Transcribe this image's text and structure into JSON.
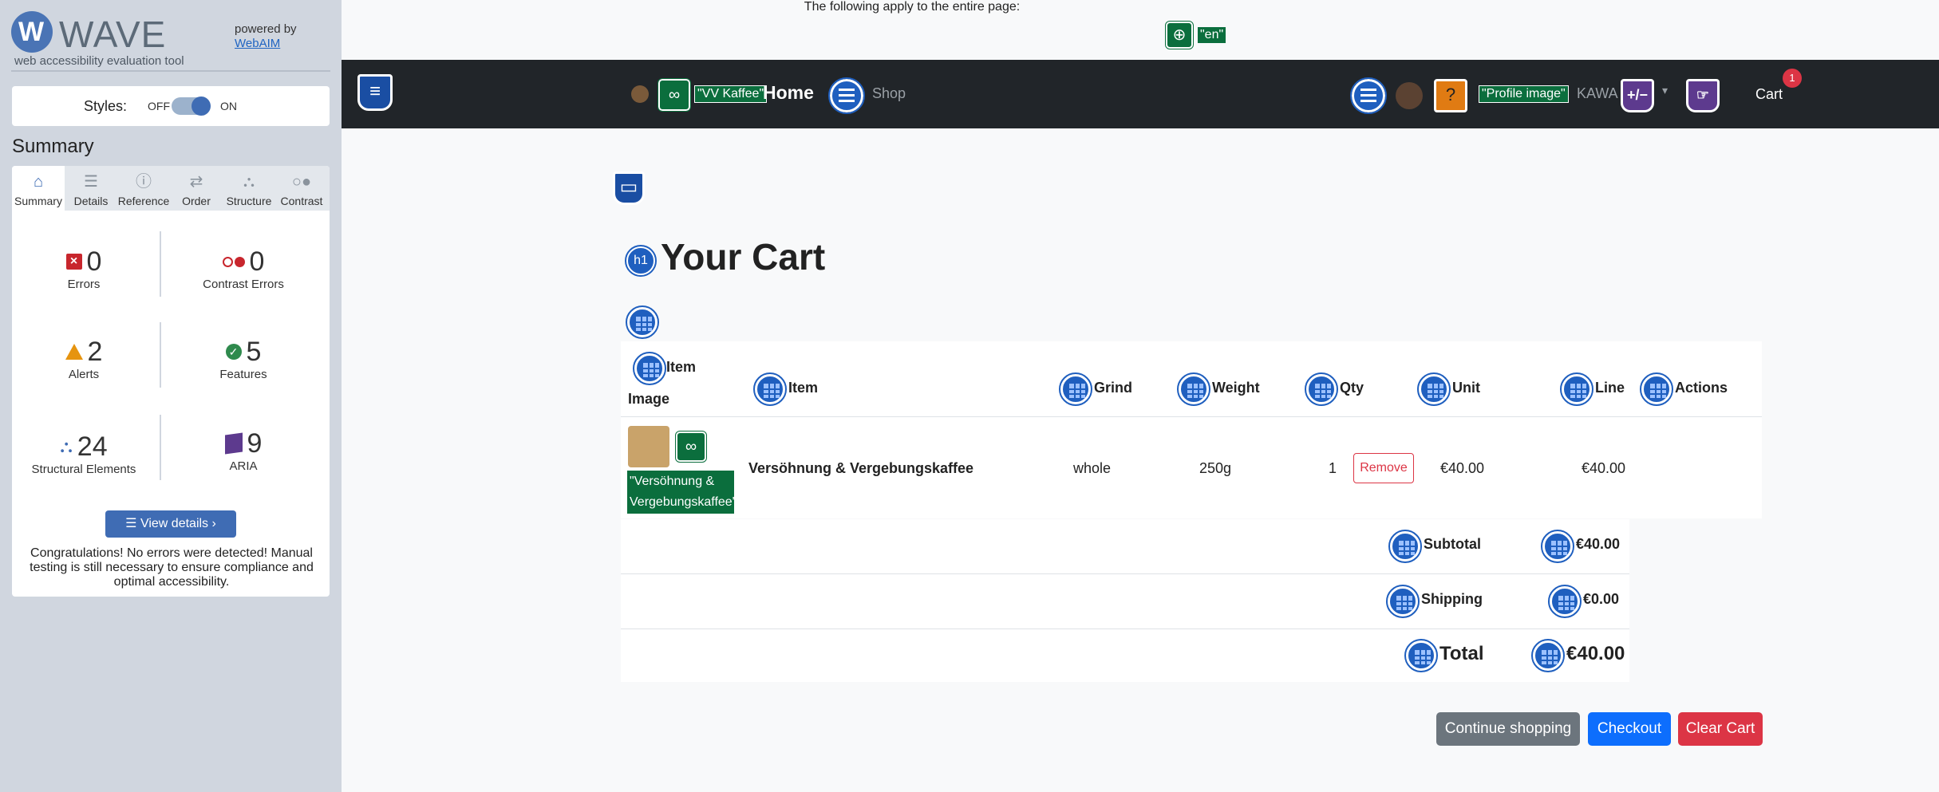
{
  "wave": {
    "brand": "WAVE",
    "tagline": "web accessibility evaluation tool",
    "powered_by": "powered by",
    "webaim": "WebAIM",
    "styles_label": "Styles:",
    "styles_off": "OFF",
    "styles_on": "ON",
    "summary_title": "Summary",
    "tabs": [
      {
        "label": "Summary",
        "icon": "home-icon"
      },
      {
        "label": "Details",
        "icon": "list-icon"
      },
      {
        "label": "Reference",
        "icon": "info-icon"
      },
      {
        "label": "Order",
        "icon": "order-icon"
      },
      {
        "label": "Structure",
        "icon": "structure-icon"
      },
      {
        "label": "Contrast",
        "icon": "contrast-icon"
      }
    ],
    "stats": {
      "errors": {
        "count": "0",
        "label": "Errors"
      },
      "contrast_errors": {
        "count": "0",
        "label": "Contrast Errors"
      },
      "alerts": {
        "count": "2",
        "label": "Alerts"
      },
      "features": {
        "count": "5",
        "label": "Features"
      },
      "structural": {
        "count": "24",
        "label": "Structural Elements"
      },
      "aria": {
        "count": "9",
        "label": "ARIA"
      }
    },
    "view_details": "View details ›",
    "congrats": "Congratulations! No errors were detected! Manual testing is still necessary to ensure compliance and optimal accessibility."
  },
  "page": {
    "lang_note": "The following apply to the entire page:",
    "lang_code": "\"en\"",
    "nav": {
      "brand_alt": "\"VV Kaffee\"",
      "home": "Home",
      "shop": "Shop",
      "profile_alt": "\"Profile image\"",
      "user": "KAWA",
      "aria_icon": "+/−",
      "cart": "Cart",
      "cart_count": "1"
    },
    "title": "Your Cart",
    "h1_badge": "h1",
    "table": {
      "headers": [
        "Item",
        "Image",
        "Item",
        "Grind",
        "Weight",
        "Qty",
        "Unit",
        "Line",
        "Actions"
      ],
      "row": {
        "image_alt": "\"Versöhnung & Vergebungskaffee\"",
        "item": "Versöhnung & Vergebungskaffee",
        "grind": "whole",
        "weight": "250g",
        "qty": "1",
        "unit": "€40.00",
        "line": "€40.00",
        "remove": "Remove"
      }
    },
    "totals": {
      "subtotal_label": "Subtotal",
      "subtotal": "€40.00",
      "shipping_label": "Shipping",
      "shipping": "€0.00",
      "total_label": "Total",
      "total": "€40.00"
    },
    "buttons": {
      "continue": "Continue shopping",
      "checkout": "Checkout",
      "clear": "Clear Cart"
    }
  },
  "colors": {
    "accent": "#3f6cb4",
    "navbar": "#212529",
    "primary": "#0d6efd",
    "danger": "#dc3545",
    "secondary": "#6c757d",
    "wave_green": "#0b6e3d"
  }
}
